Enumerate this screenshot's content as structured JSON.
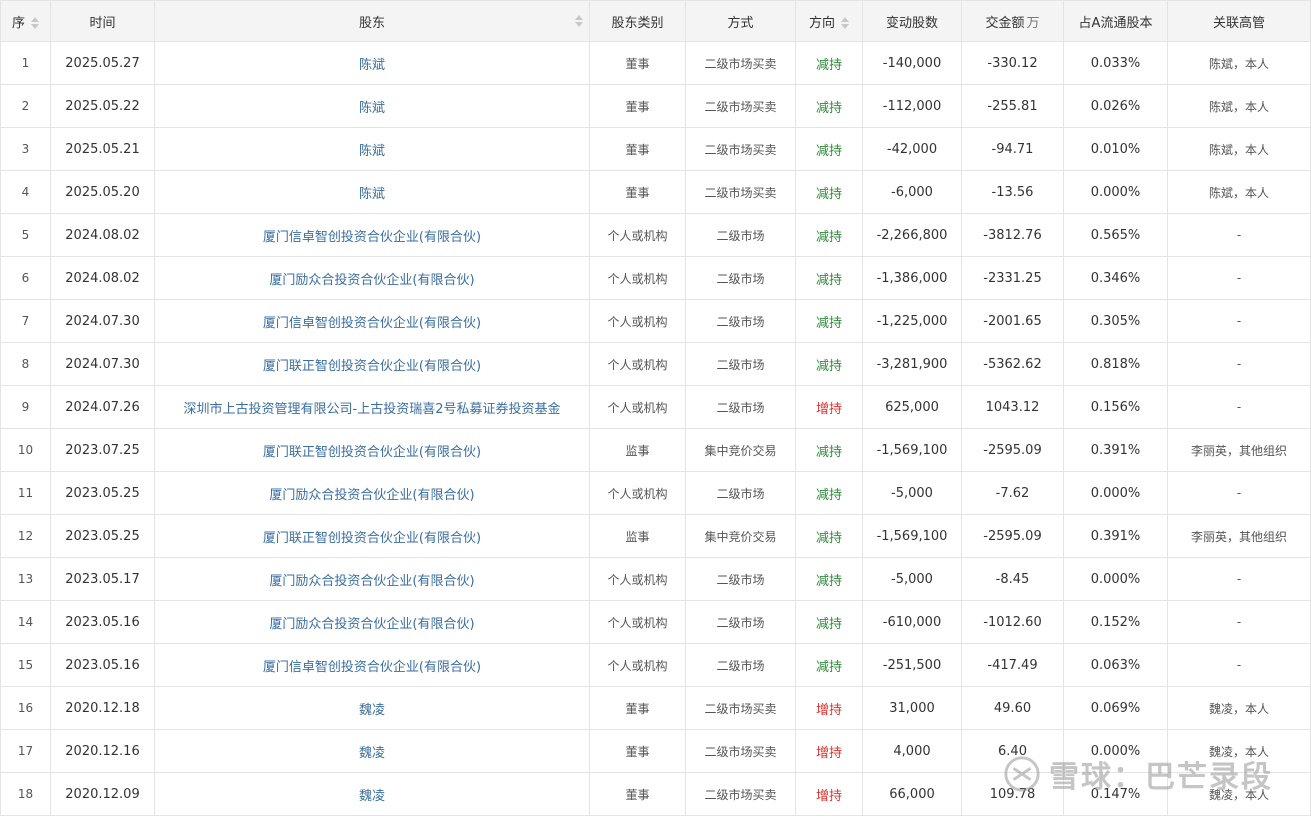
{
  "colors": {
    "decrease": "#2e8b3a",
    "increase": "#e02f2f",
    "link": "#3a6ea5",
    "header_bg": "#f4f4f4",
    "border": "#e4e4e4"
  },
  "headers": {
    "seq": "序",
    "date": "时间",
    "holder": "股东",
    "type": "股东类别",
    "method": "方式",
    "direction": "方向",
    "shares": "变动股数",
    "amount": "交金额",
    "amount_unit": "万",
    "ratio": "占A流通股本",
    "related": "关联高管"
  },
  "rows": [
    {
      "seq": "1",
      "date": "2025.05.27",
      "holder": "陈斌",
      "type": "董事",
      "method": "二级市场买卖",
      "direction": "减持",
      "dir_kind": "decrease",
      "shares": "-140,000",
      "amount": "-330.12",
      "ratio": "0.033%",
      "related": "陈斌，本人"
    },
    {
      "seq": "2",
      "date": "2025.05.22",
      "holder": "陈斌",
      "type": "董事",
      "method": "二级市场买卖",
      "direction": "减持",
      "dir_kind": "decrease",
      "shares": "-112,000",
      "amount": "-255.81",
      "ratio": "0.026%",
      "related": "陈斌，本人"
    },
    {
      "seq": "3",
      "date": "2025.05.21",
      "holder": "陈斌",
      "type": "董事",
      "method": "二级市场买卖",
      "direction": "减持",
      "dir_kind": "decrease",
      "shares": "-42,000",
      "amount": "-94.71",
      "ratio": "0.010%",
      "related": "陈斌，本人"
    },
    {
      "seq": "4",
      "date": "2025.05.20",
      "holder": "陈斌",
      "type": "董事",
      "method": "二级市场买卖",
      "direction": "减持",
      "dir_kind": "decrease",
      "shares": "-6,000",
      "amount": "-13.56",
      "ratio": "0.000%",
      "related": "陈斌，本人"
    },
    {
      "seq": "5",
      "date": "2024.08.02",
      "holder": "厦门信卓智创投资合伙企业(有限合伙)",
      "type": "个人或机构",
      "method": "二级市场",
      "direction": "减持",
      "dir_kind": "decrease",
      "shares": "-2,266,800",
      "amount": "-3812.76",
      "ratio": "0.565%",
      "related": "-"
    },
    {
      "seq": "6",
      "date": "2024.08.02",
      "holder": "厦门励众合投资合伙企业(有限合伙)",
      "type": "个人或机构",
      "method": "二级市场",
      "direction": "减持",
      "dir_kind": "decrease",
      "shares": "-1,386,000",
      "amount": "-2331.25",
      "ratio": "0.346%",
      "related": "-"
    },
    {
      "seq": "7",
      "date": "2024.07.30",
      "holder": "厦门信卓智创投资合伙企业(有限合伙)",
      "type": "个人或机构",
      "method": "二级市场",
      "direction": "减持",
      "dir_kind": "decrease",
      "shares": "-1,225,000",
      "amount": "-2001.65",
      "ratio": "0.305%",
      "related": "-"
    },
    {
      "seq": "8",
      "date": "2024.07.30",
      "holder": "厦门联正智创投资合伙企业(有限合伙)",
      "type": "个人或机构",
      "method": "二级市场",
      "direction": "减持",
      "dir_kind": "decrease",
      "shares": "-3,281,900",
      "amount": "-5362.62",
      "ratio": "0.818%",
      "related": "-"
    },
    {
      "seq": "9",
      "date": "2024.07.26",
      "holder": "深圳市上古投资管理有限公司-上古投资瑞喜2号私募证券投资基金",
      "type": "个人或机构",
      "method": "二级市场",
      "direction": "增持",
      "dir_kind": "increase",
      "shares": "625,000",
      "amount": "1043.12",
      "ratio": "0.156%",
      "related": "-"
    },
    {
      "seq": "10",
      "date": "2023.07.25",
      "holder": "厦门联正智创投资合伙企业(有限合伙)",
      "type": "监事",
      "method": "集中竞价交易",
      "direction": "减持",
      "dir_kind": "decrease",
      "shares": "-1,569,100",
      "amount": "-2595.09",
      "ratio": "0.391%",
      "related": "李丽英，其他组织"
    },
    {
      "seq": "11",
      "date": "2023.05.25",
      "holder": "厦门励众合投资合伙企业(有限合伙)",
      "type": "个人或机构",
      "method": "二级市场",
      "direction": "减持",
      "dir_kind": "decrease",
      "shares": "-5,000",
      "amount": "-7.62",
      "ratio": "0.000%",
      "related": "-"
    },
    {
      "seq": "12",
      "date": "2023.05.25",
      "holder": "厦门联正智创投资合伙企业(有限合伙)",
      "type": "监事",
      "method": "集中竞价交易",
      "direction": "减持",
      "dir_kind": "decrease",
      "shares": "-1,569,100",
      "amount": "-2595.09",
      "ratio": "0.391%",
      "related": "李丽英，其他组织"
    },
    {
      "seq": "13",
      "date": "2023.05.17",
      "holder": "厦门励众合投资合伙企业(有限合伙)",
      "type": "个人或机构",
      "method": "二级市场",
      "direction": "减持",
      "dir_kind": "decrease",
      "shares": "-5,000",
      "amount": "-8.45",
      "ratio": "0.000%",
      "related": "-"
    },
    {
      "seq": "14",
      "date": "2023.05.16",
      "holder": "厦门励众合投资合伙企业(有限合伙)",
      "type": "个人或机构",
      "method": "二级市场",
      "direction": "减持",
      "dir_kind": "decrease",
      "shares": "-610,000",
      "amount": "-1012.60",
      "ratio": "0.152%",
      "related": "-"
    },
    {
      "seq": "15",
      "date": "2023.05.16",
      "holder": "厦门信卓智创投资合伙企业(有限合伙)",
      "type": "个人或机构",
      "method": "二级市场",
      "direction": "减持",
      "dir_kind": "decrease",
      "shares": "-251,500",
      "amount": "-417.49",
      "ratio": "0.063%",
      "related": "-"
    },
    {
      "seq": "16",
      "date": "2020.12.18",
      "holder": "魏凌",
      "type": "董事",
      "method": "二级市场买卖",
      "direction": "增持",
      "dir_kind": "increase",
      "shares": "31,000",
      "amount": "49.60",
      "ratio": "0.069%",
      "related": "魏凌，本人"
    },
    {
      "seq": "17",
      "date": "2020.12.16",
      "holder": "魏凌",
      "type": "董事",
      "method": "二级市场买卖",
      "direction": "增持",
      "dir_kind": "increase",
      "shares": "4,000",
      "amount": "6.40",
      "ratio": "0.000%",
      "related": "魏凌，本人"
    },
    {
      "seq": "18",
      "date": "2020.12.09",
      "holder": "魏凌",
      "type": "董事",
      "method": "二级市场买卖",
      "direction": "增持",
      "dir_kind": "increase",
      "shares": "66,000",
      "amount": "109.78",
      "ratio": "0.147%",
      "related": "魏凌，本人"
    }
  ],
  "watermark": {
    "text": "雪球：巴芒录段",
    "icon": "snowball-logo-icon"
  }
}
